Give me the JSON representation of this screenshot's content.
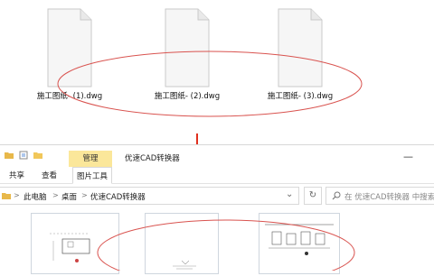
{
  "files": [
    {
      "name": "施工图纸- (1).dwg",
      "icon": "document-icon"
    },
    {
      "name": "施工图纸- (2).dwg",
      "icon": "document-icon"
    },
    {
      "name": "施工图纸- (3).dwg",
      "icon": "document-icon"
    }
  ],
  "window": {
    "contextual_tab": "管理",
    "title": "优速CAD转换器",
    "minimize_glyph": "—"
  },
  "ribbon": {
    "tabs": [
      {
        "label": "共享"
      },
      {
        "label": "查看"
      },
      {
        "label": "图片工具"
      }
    ]
  },
  "address": {
    "crumbs": [
      "此电脑",
      "桌面",
      "优速CAD转换器"
    ],
    "separator": ">",
    "dropdown_glyph": "⌄",
    "refresh_glyph": "↻"
  },
  "search": {
    "placeholder": "在 优速CAD转换器 中搜索"
  },
  "colors": {
    "annotation_ellipse": "#d9534f",
    "annotation_arrow": "#e0301e",
    "contextual_tab_bg": "#fbe79a",
    "folder": "#e8b84a"
  }
}
